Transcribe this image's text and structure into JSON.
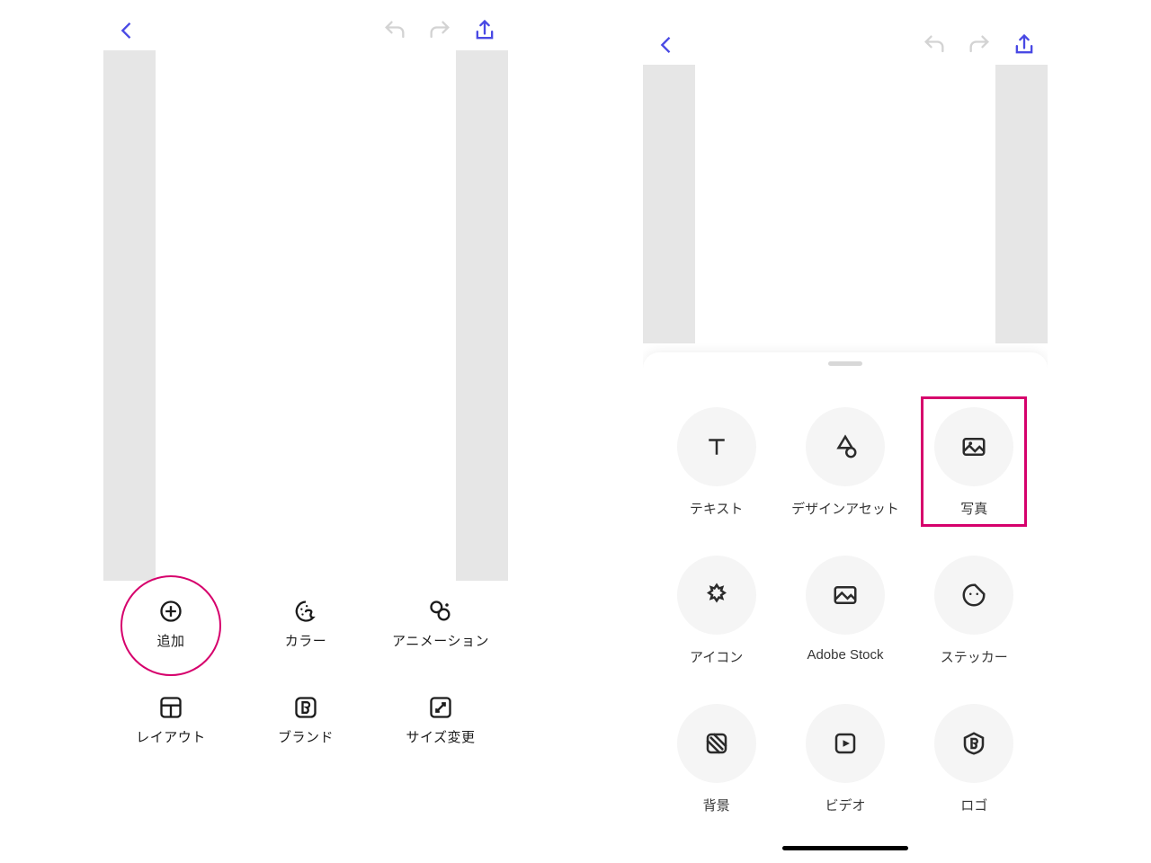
{
  "left": {
    "topbar": {
      "back": "back-icon",
      "undo": "undo-icon",
      "redo": "redo-icon",
      "share": "share-icon"
    },
    "tools": [
      {
        "id": "add",
        "label": "追加",
        "icon": "plus-circle-icon",
        "highlighted": true
      },
      {
        "id": "color",
        "label": "カラー",
        "icon": "palette-icon"
      },
      {
        "id": "anim",
        "label": "アニメーション",
        "icon": "animation-icon"
      },
      {
        "id": "layout",
        "label": "レイアウト",
        "icon": "layout-icon"
      },
      {
        "id": "brand",
        "label": "ブランド",
        "icon": "brand-b-icon"
      },
      {
        "id": "resize",
        "label": "サイズ変更",
        "icon": "resize-icon"
      }
    ]
  },
  "right": {
    "topbar": {
      "back": "back-icon",
      "undo": "undo-icon",
      "redo": "redo-icon",
      "share": "share-icon"
    },
    "assets": [
      {
        "id": "text",
        "label": "テキスト",
        "icon": "text-t-icon"
      },
      {
        "id": "design",
        "label": "デザインアセット",
        "icon": "shapes-icon"
      },
      {
        "id": "photo",
        "label": "写真",
        "icon": "photo-icon",
        "highlighted": true
      },
      {
        "id": "icon",
        "label": "アイコン",
        "icon": "burst-icon"
      },
      {
        "id": "stock",
        "label": "Adobe Stock",
        "icon": "image-icon"
      },
      {
        "id": "sticker",
        "label": "ステッカー",
        "icon": "sticker-icon"
      },
      {
        "id": "bg",
        "label": "背景",
        "icon": "pattern-icon"
      },
      {
        "id": "video",
        "label": "ビデオ",
        "icon": "video-icon"
      },
      {
        "id": "logo",
        "label": "ロゴ",
        "icon": "logo-b-icon"
      }
    ]
  },
  "colors": {
    "accent": "#4949e4",
    "muted": "#d3d3d3",
    "highlight": "#d6006c"
  }
}
